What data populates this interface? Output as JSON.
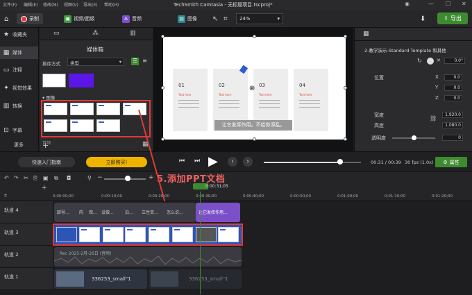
{
  "menu": {
    "items": [
      "文件(F)",
      "编辑(E)",
      "修改(M)",
      "视图(V)",
      "导出(E)",
      "帮助(H)"
    ],
    "title": "TechSmith Camtasia - 无标题项目.tscproj*"
  },
  "toolbar": {
    "record": "录制",
    "tools": [
      "视频/面级",
      "音频",
      "图像"
    ],
    "zoom": "24%",
    "export": "导出"
  },
  "sidebar": {
    "items": [
      "收藏夹",
      "媒体",
      "注释",
      "视觉效果",
      "转换",
      "字幕"
    ],
    "more": "更多"
  },
  "mediabin": {
    "title": "媒体箱",
    "sort_label": "排序方式",
    "sort_value": "类型",
    "section_image": "图像",
    "section_audio": "音频"
  },
  "canvas": {
    "cards": [
      {
        "num": "01",
        "title": "Text here"
      },
      {
        "num": "02",
        "title": "Text here"
      },
      {
        "num": "03",
        "title": "Text here"
      },
      {
        "num": "04",
        "title": "Text here"
      }
    ],
    "caption": "让它发挥作用。不给你添乱。"
  },
  "props": {
    "title": "2-教学演示-Standard Template 和其他",
    "rotation": "0.0°",
    "position_label": "位置",
    "x": "0.0",
    "y": "0.0",
    "z": "0.0",
    "width_label": "宽度",
    "width": "1,920.0",
    "height_label": "高度",
    "height": "1,080.0",
    "opacity_label": "透明度",
    "opacity": "0"
  },
  "playbar": {
    "guide": "快速入门指南",
    "buy": "立即购买!",
    "time": "00:31 / 00:39",
    "fps": "30 fps (1.0x)",
    "properties": "属性"
  },
  "timeline": {
    "playhead": "0:00:31;05",
    "ruler": [
      "0:00:00;00",
      "0:00:10;00",
      "0:00:20;00",
      "0:00:30;00",
      "0:00:40;00",
      "0:00:50;00",
      "0:01:00;00",
      "0:01:10;00",
      "0:01:20;00"
    ],
    "tracks": [
      "轨道 4",
      "轨道 3",
      "轨道 2",
      "轨道 1"
    ],
    "track4_clips": [
      "卸导...",
      "肉",
      "观...",
      "设做...",
      "沿...",
      "立性变...",
      "怎么说...",
      "让它发挥作用..."
    ],
    "track2_clip": "Rec 2025-2月-26日 (音频)",
    "track1_clip": "336253_small\"1",
    "track1_clip2": "336253_small\"1"
  },
  "annotation": "5.添加PPT文档",
  "colors": {
    "accent": "#3d8b2e",
    "annotation": "#e53935",
    "buy": "#f0b400",
    "purple": "#7a4fc9"
  }
}
